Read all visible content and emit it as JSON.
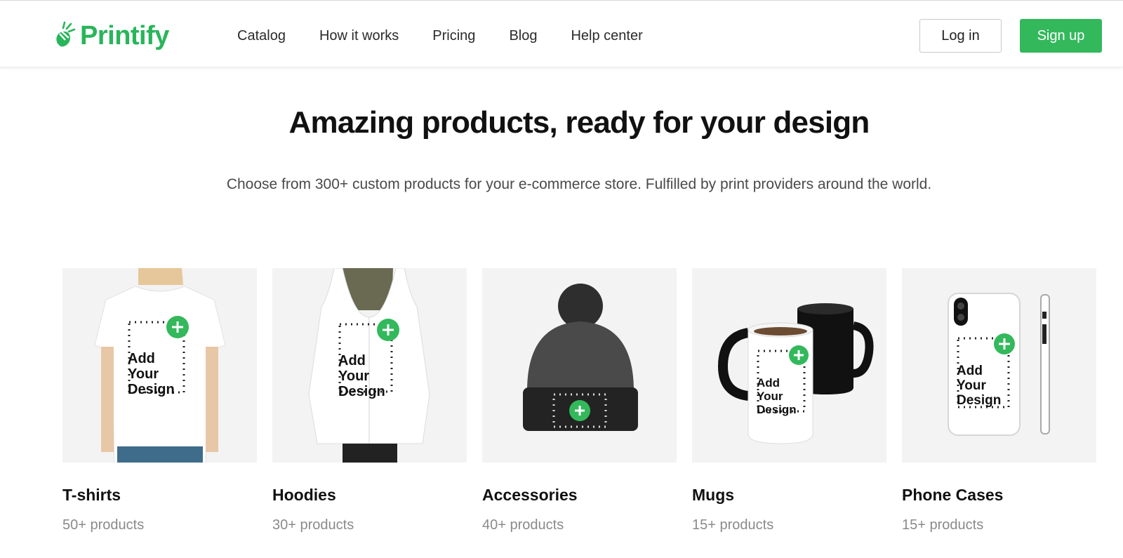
{
  "brand": {
    "name": "Printify",
    "color": "#29b55a"
  },
  "nav": {
    "items": [
      "Catalog",
      "How it works",
      "Pricing",
      "Blog",
      "Help center"
    ],
    "login_label": "Log in",
    "signup_label": "Sign up"
  },
  "hero": {
    "title": "Amazing products, ready for your design",
    "subtitle": "Choose from 300+ custom products for your e-commerce store. Fulfilled by print providers around the world."
  },
  "design_placeholder": {
    "line1": "Add",
    "line2": "Your",
    "line3": "Design"
  },
  "categories": [
    {
      "name": "T-shirts",
      "count": "50+ products",
      "image": "tshirt-icon"
    },
    {
      "name": "Hoodies",
      "count": "30+ products",
      "image": "hoodie-icon"
    },
    {
      "name": "Accessories",
      "count": "40+ products",
      "image": "beanie-icon"
    },
    {
      "name": "Mugs",
      "count": "15+ products",
      "image": "mug-icon"
    },
    {
      "name": "Phone Cases",
      "count": "15+ products",
      "image": "phone-case-icon"
    }
  ],
  "colors": {
    "accent": "#33b85c",
    "text": "#111111",
    "muted": "#8a8a8a",
    "tile_bg": "#f3f3f3"
  }
}
